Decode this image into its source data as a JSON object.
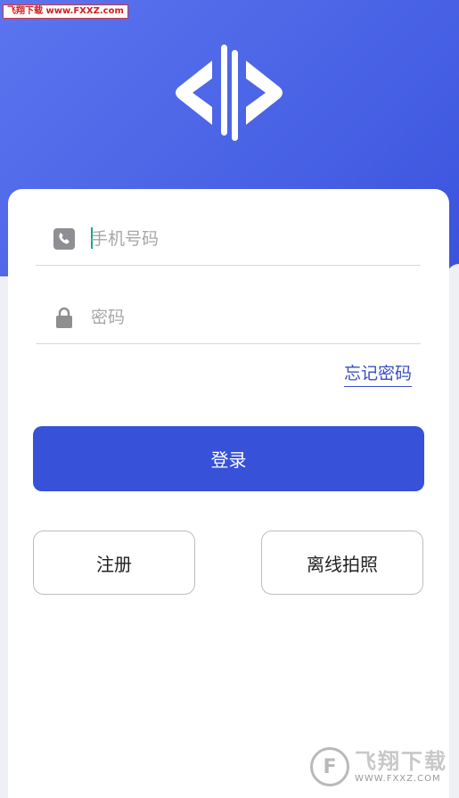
{
  "watermark": {
    "top_text": "飞翔下载 www.FXXZ.com",
    "bottom_cn": "飞翔下载",
    "bottom_en": "WWW.FXXZ.COM",
    "bottom_letter": "F"
  },
  "login": {
    "phone_placeholder": "手机号码",
    "password_placeholder": "密码",
    "forgot_label": "忘记密码",
    "login_label": "登录",
    "register_label": "注册",
    "offline_photo_label": "离线拍照"
  },
  "colors": {
    "primary": "#3751d8",
    "header_gradient_start": "#5b74ee",
    "header_gradient_end": "#3a53dc",
    "link": "#3a4fbf"
  },
  "icons": {
    "logo": "code-brackets-logo",
    "phone": "phone-icon",
    "password": "lock-icon"
  }
}
